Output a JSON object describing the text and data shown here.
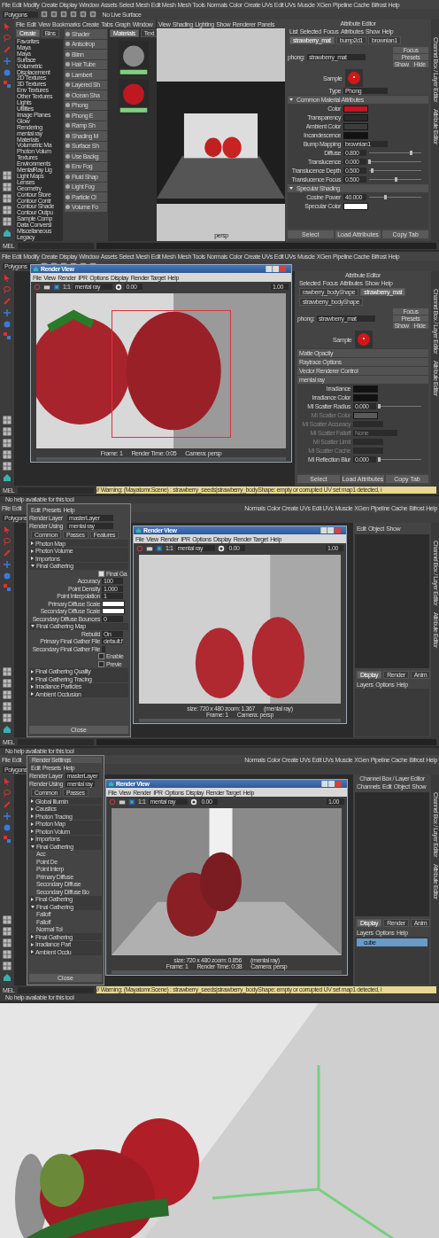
{
  "panels": [
    {
      "menu": [
        "File",
        "Edit",
        "Modify",
        "Create",
        "Display",
        "Window",
        "Assets",
        "Select",
        "Mesh",
        "Edit Mesh",
        "Mesh Tools",
        "Normals",
        "Color",
        "Create UVs",
        "Edit UVs",
        "Muscle",
        "XGen",
        "Pipeline Cache",
        "Bifrost",
        "Help"
      ],
      "shelf": {
        "mode": "Polygons",
        "live": "No Live Surface"
      },
      "hypershade": {
        "menu": [
          "File",
          "Edit",
          "View",
          "Bookmarks",
          "Create",
          "Tabs",
          "Graph",
          "Window"
        ],
        "tabs": [
          {
            "label": "Create",
            "selected": true
          },
          {
            "label": "Bins",
            "selected": false
          }
        ],
        "tree": [
          "Favorites",
          "Maya",
          "Maya",
          "Surface",
          "Volumetric",
          "Displacement",
          "2D Textures",
          "3D Textures",
          "Env Textures",
          "Other Textures",
          "Lights",
          "Utilities",
          "Image Planes",
          "Glow",
          "Rendering",
          "mental ray",
          "Materials",
          "Volumetric Ma",
          "Photon Volum",
          "Textures",
          "Environments",
          "MentalRay Lig",
          "Light Maps",
          "Lenses",
          "Geometry",
          "Contour Store",
          "Contour Contr",
          "Contour Shade",
          "Contour Outpu",
          "Sample Comp",
          "Data Conversi",
          "Miscellaneous",
          "Legacy"
        ],
        "nodes": [
          "Shader",
          "Anisotrop",
          "Blinn",
          "Hair Tube",
          "Lambert",
          "Layered Sh",
          "Ocean Sha",
          "Phong",
          "Phong E",
          "Ramp Sh",
          "Shading M",
          "Surface Sh",
          "Use Backg",
          "Env Fog",
          "Fluid Shap",
          "Light Fog",
          "Particle Cl",
          "Volume Fo"
        ],
        "swatch_tabs": [
          {
            "label": "Materials",
            "selected": true
          },
          {
            "label": "Text",
            "selected": false
          }
        ],
        "swatches": [
          {
            "color": "#8a8a8a"
          },
          {
            "color": "#c01820"
          }
        ]
      },
      "viewport": {
        "kind": "box",
        "menu": [
          "View",
          "Shading",
          "Lighting",
          "Show",
          "Renderer",
          "Panels"
        ],
        "camera": "persp"
      },
      "attribute_editor": {
        "title": "Attribute Editor",
        "menu": [
          "List",
          "Selected",
          "Focus",
          "Attributes",
          "Show",
          "Help"
        ],
        "tabs": [
          {
            "label": "strawberry_mat",
            "selected": true
          },
          {
            "label": "bump2d1",
            "selected": false
          },
          {
            "label": "brownian1",
            "selected": false
          }
        ],
        "node_type": "phong:",
        "node_name": "strawberry_mat",
        "side_buttons": [
          "Focus",
          "Presets",
          "Show",
          "Hide"
        ],
        "sample": "Sample",
        "type_label": "Type",
        "type_value": "Phong",
        "rows": [
          {
            "kind": "section",
            "label": "Common Material Attributes",
            "expanded": true
          },
          {
            "kind": "color",
            "label": "Color",
            "color": "#c01820"
          },
          {
            "kind": "color",
            "label": "Transparency",
            "color": "#2a2a2a"
          },
          {
            "kind": "color",
            "label": "Ambient Color",
            "color": "#3c3c3c"
          },
          {
            "kind": "color",
            "label": "Incandescence",
            "color": "#111111"
          },
          {
            "kind": "dropdown",
            "label": "Bump Mapping",
            "value": "brownian1"
          },
          {
            "kind": "number",
            "label": "Diffuse",
            "value": "0.800",
            "level": 0.8
          },
          {
            "kind": "number",
            "label": "Translucence",
            "value": "0.000",
            "level": 0
          },
          {
            "kind": "number",
            "label": "Translucence Depth",
            "value": "0.500",
            "level": 0.05
          },
          {
            "kind": "number",
            "label": "Translucence Focus",
            "value": "0.500",
            "level": 0.5
          },
          {
            "kind": "section",
            "label": "Specular Shading",
            "expanded": true
          },
          {
            "kind": "number",
            "label": "Cosine Power",
            "value": "40.000",
            "level": 0.3
          },
          {
            "kind": "color",
            "label": "Specular Color",
            "color": "#ffffff"
          }
        ],
        "buttons": [
          "Select",
          "Load Attributes",
          "Copy Tab"
        ]
      },
      "side_tabs": [
        "Channel Box / Layer Editor",
        "Attribute Editor"
      ],
      "command": {
        "label": "MEL"
      }
    },
    {
      "menu": [
        "File",
        "Edit",
        "Modify",
        "Create",
        "Display",
        "Window",
        "Assets",
        "Select",
        "Mesh",
        "Edit Mesh",
        "Mesh Tools",
        "Normals",
        "Color",
        "Create UVs",
        "Edit UVs",
        "Muscle",
        "XGen",
        "Pipeline Cache",
        "Bifrost",
        "Help"
      ],
      "shelf": {
        "mode": "Polygons"
      },
      "viewport": {
        "kind": "dark"
      },
      "render_view": {
        "kind": "closeup",
        "title": "Render View",
        "menu": [
          "File",
          "View",
          "Render",
          "IPR",
          "Options",
          "Display",
          "Render Target",
          "Help"
        ],
        "renderer": "mental ray",
        "exposure": "0.00",
        "ratio": "1:1",
        "gamma": "1.00",
        "region": true,
        "info": [
          [
            "Frame: 1",
            "Render Time: 0:05",
            "Camera: persp"
          ]
        ]
      },
      "attribute_editor": {
        "title": "Attribute Editor",
        "menu": [
          "Selected",
          "Focus",
          "Attributes",
          "Show",
          "Help"
        ],
        "tabs": [
          {
            "label": "rawberry_bodyShape",
            "selected": false
          },
          {
            "label": "strawberry_mat",
            "selected": true
          },
          {
            "label": "strawberry_bodyShape",
            "selected": false
          }
        ],
        "node_type": "phong:",
        "node_name": "strawberry_mat",
        "side_buttons": [
          "Focus",
          "Presets",
          "Show",
          "Hide"
        ],
        "sample": "Sample",
        "rows": [
          {
            "kind": "section",
            "label": "Matte Opacity"
          },
          {
            "kind": "section",
            "label": "Raytrace Options"
          },
          {
            "kind": "section",
            "label": "Vector Renderer Control"
          },
          {
            "kind": "section",
            "label": "mental ray"
          },
          {
            "kind": "color",
            "label": "Irradiance",
            "color": "#111111"
          },
          {
            "kind": "color",
            "label": "Irradiance Color",
            "color": "#111111"
          },
          {
            "kind": "number",
            "label": "MI Scatter Radius",
            "value": "0.000",
            "level": 0
          },
          {
            "kind": "color",
            "label": "MI Scatter Color",
            "color": "#5a5a5a",
            "disabled": true
          },
          {
            "kind": "plain",
            "label": "MI Scatter Accuracy",
            "disabled": true
          },
          {
            "kind": "dropdown",
            "label": "MI Scatter Falloff",
            "value": "None",
            "disabled": true
          },
          {
            "kind": "plain",
            "label": "MI Scatter Limit",
            "disabled": true
          },
          {
            "kind": "plain",
            "label": "MI Scatter Cache",
            "disabled": true
          },
          {
            "kind": "number",
            "label": "MI Reflection Blur",
            "value": "0.000",
            "level": 0
          }
        ],
        "buttons": [
          "Select",
          "Load Attributes",
          "Copy Tab"
        ]
      },
      "side_tabs": [
        "Channel Box / Layer Editor",
        "Attribute Editor"
      ],
      "command": {
        "label": "MEL",
        "warning": "// Warning: (Mayatomr.Scene) : strawberry_seeds|strawberry_bodyShape: empty or corrupted UV set map1 detected, i"
      }
    },
    {
      "help_top": "No help available for this tool",
      "menu": [
        "File",
        "Edit"
      ],
      "menu_right": [
        "Normals",
        "Color",
        "Create UVs",
        "Edit UVs",
        "Muscle",
        "XGen",
        "Pipeline Cache",
        "Bifrost",
        "Help"
      ],
      "shelf": {
        "mode": "Polygons"
      },
      "viewport": {
        "kind": "dark"
      },
      "render_settings": {
        "menu": [
          "Edit",
          "Presets",
          "Help"
        ],
        "layer_label": "Render Layer",
        "layer": "masterLayer",
        "using_label": "Render Using",
        "using": "mental ray",
        "tabs": [
          {
            "label": "Common",
            "selected": false
          },
          {
            "label": "Passes",
            "selected": false
          },
          {
            "label": "Features",
            "selected": false
          }
        ],
        "rows": [
          {
            "kind": "section",
            "label": "Photon Map",
            "expanded": false
          },
          {
            "kind": "section",
            "label": "Photon Volume",
            "expanded": false
          },
          {
            "kind": "section",
            "label": "Importons",
            "expanded": false
          },
          {
            "kind": "section",
            "label": "Final Gathering",
            "expanded": true
          },
          {
            "kind": "check",
            "label": "Final Ga",
            "checked": true
          },
          {
            "kind": "field",
            "label": "Accuracy",
            "value": "100"
          },
          {
            "kind": "field",
            "label": "Point Density",
            "value": "1.000"
          },
          {
            "kind": "field",
            "label": "Point Interpolation",
            "value": "1"
          },
          {
            "kind": "swatch",
            "label": "Primary Diffuse Scale",
            "color": "#ffffff"
          },
          {
            "kind": "swatch",
            "label": "Secondary Diffuse Scale",
            "color": "#ffffff"
          },
          {
            "kind": "field",
            "label": "Secondary Diffuse Bounces",
            "value": "0"
          },
          {
            "kind": "section",
            "label": "Final Gathering Map",
            "expanded": true
          },
          {
            "kind": "field",
            "label": "Rebuild",
            "value": "On"
          },
          {
            "kind": "field",
            "label": "Primary Final Gather File",
            "value": "default.f"
          },
          {
            "kind": "blank",
            "label": "Secondary Final Gather File"
          },
          {
            "kind": "check",
            "label": "Enable",
            "checked": false
          },
          {
            "kind": "check",
            "label": "Previe",
            "checked": false
          },
          {
            "kind": "section",
            "label": "Final Gathering Quality",
            "expanded": false
          },
          {
            "kind": "section",
            "label": "Final Gathering Tracing",
            "expanded": false
          },
          {
            "kind": "section",
            "label": "Irradiance Particles",
            "expanded": false
          },
          {
            "kind": "section",
            "label": "Ambient Occlusion",
            "expanded": false
          }
        ],
        "close": "Close"
      },
      "render_view": {
        "kind": "pair",
        "title": "Render View",
        "menu": [
          "File",
          "View",
          "Render",
          "IPR",
          "Options",
          "Display",
          "Render Target",
          "Help"
        ],
        "renderer": "mental ray",
        "exposure": "0.00",
        "ratio": "1:1",
        "gamma": "1.00",
        "region": false,
        "info": [
          [
            "size: 720 x 480 zoom: 1.367",
            "(mental ray)"
          ],
          [
            "Frame: 1",
            "Camera: persp"
          ]
        ]
      },
      "channel_box": {
        "menu": [
          "Edit",
          "Object",
          "Show"
        ],
        "layer_tabs": [
          {
            "label": "Display",
            "selected": true
          },
          {
            "label": "Render",
            "selected": false
          },
          {
            "label": "Anim",
            "selected": false
          }
        ],
        "layer_menu": [
          "Layers",
          "Options",
          "Help"
        ]
      },
      "side_tabs": [
        "Channel Box / Layer Editor",
        "Attribute Editor"
      ],
      "command": {
        "label": "MEL"
      }
    },
    {
      "help_top": "No help available for this tool",
      "menu": [
        "File",
        "Edit"
      ],
      "menu_right": [
        "Normals",
        "Color",
        "Create UVs",
        "Edit UVs",
        "Muscle",
        "XGen",
        "Pipeline Cache",
        "Bifrost",
        "Help"
      ],
      "shelf": {
        "mode": "Polygons"
      },
      "viewport": {
        "kind": "dark"
      },
      "render_settings": {
        "title": "Render Settings",
        "menu": [
          "Edit",
          "Presets",
          "Help"
        ],
        "layer_label": "Render Layer",
        "layer": "masterLayer",
        "using_label": "Render Using",
        "using": "mental ray",
        "tabs": [
          {
            "label": "Common",
            "selected": false
          },
          {
            "label": "Passes",
            "selected": false
          }
        ],
        "rows": [
          {
            "kind": "section",
            "label": "Global Illumin",
            "expanded": false
          },
          {
            "kind": "section",
            "label": "Caustics",
            "expanded": false
          },
          {
            "kind": "section",
            "label": "Photon Tracing",
            "expanded": false
          },
          {
            "kind": "section",
            "label": "Photon Map",
            "expanded": false
          },
          {
            "kind": "section",
            "label": "Photon Volum",
            "expanded": false
          },
          {
            "kind": "section",
            "label": "Importons",
            "expanded": false
          },
          {
            "kind": "section",
            "label": "Final Gathering",
            "expanded": true
          },
          {
            "kind": "field",
            "label": "Acc"
          },
          {
            "kind": "field",
            "label": "Point De"
          },
          {
            "kind": "field",
            "label": "Point Interp"
          },
          {
            "kind": "field",
            "label": "Primary Diffuse"
          },
          {
            "kind": "field",
            "label": "Secondary Diffuse"
          },
          {
            "kind": "field",
            "label": "Secondary Diffuse Bo"
          },
          {
            "kind": "section",
            "label": "Final Gathering",
            "expanded": false
          },
          {
            "kind": "section",
            "label": "Final Gathering",
            "expanded": true
          },
          {
            "kind": "field",
            "label": "Falloff"
          },
          {
            "kind": "field",
            "label": "Falloff"
          },
          {
            "kind": "field",
            "label": "Normal Tol"
          },
          {
            "kind": "section",
            "label": "Final Gathering",
            "expanded": false
          },
          {
            "kind": "section",
            "label": "Irradiance Part",
            "expanded": false
          },
          {
            "kind": "section",
            "label": "Ambient Occlu",
            "expanded": false
          }
        ],
        "close": "Close"
      },
      "render_view": {
        "kind": "corner",
        "title": "Render View",
        "menu": [
          "File",
          "View",
          "Render",
          "IPR",
          "Options",
          "Display",
          "Render Target",
          "Help"
        ],
        "renderer": "mental ray",
        "exposure": "0.00",
        "ratio": "1:1",
        "gamma": "1.00",
        "region": false,
        "info": [
          [
            "size: 720 x 480 zoom: 0.856",
            "(mental ray)"
          ],
          [
            "Frame: 1",
            "Render Time: 0:38",
            "Camera: persp"
          ]
        ]
      },
      "channel_box": {
        "title": "Channel Box / Layer Editor",
        "menu": [
          "Channels",
          "Edit",
          "Object",
          "Show"
        ],
        "layer_tabs": [
          {
            "label": "Display",
            "selected": true
          },
          {
            "label": "Render",
            "selected": false
          },
          {
            "label": "Anim",
            "selected": false
          }
        ],
        "layer_menu": [
          "Layers",
          "Options",
          "Help"
        ],
        "layers": [
          {
            "label": "cube",
            "selected": true
          }
        ]
      },
      "side_tabs": [
        "Channel Box / Layer Editor",
        "Attribute Editor"
      ],
      "command": {
        "label": "MEL",
        "warning": "// Warning: (Mayatomr.Scene) : strawberry_seeds|strawberry_bodyShape: empty or corrupted UV set map1 detected, i"
      },
      "help_bottom": "No help available for this tool"
    }
  ]
}
